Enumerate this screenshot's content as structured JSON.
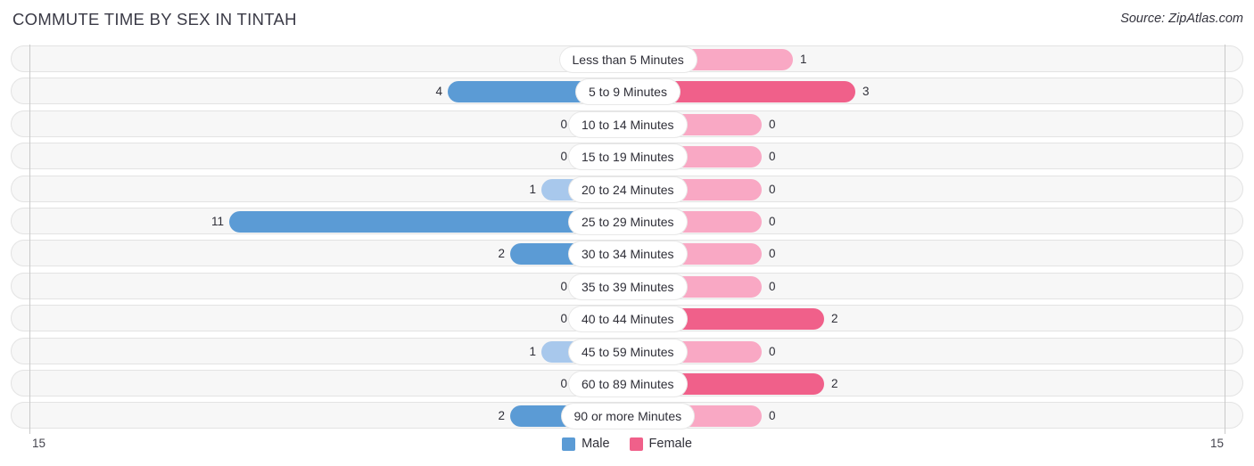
{
  "header": {
    "title": "COMMUTE TIME BY SEX IN TINTAH",
    "source": "Source: ZipAtlas.com"
  },
  "legend": {
    "male_label": "Male",
    "female_label": "Female",
    "male_color": "#5b9bd5",
    "female_color": "#f0608a"
  },
  "axis": {
    "left_tick": "15",
    "right_tick": "15",
    "max": 15
  },
  "chart_data": {
    "type": "bar",
    "orientation": "horizontal-diverging",
    "title": "COMMUTE TIME BY SEX IN TINTAH",
    "xlabel": "",
    "ylabel": "",
    "xlim": [
      15,
      15
    ],
    "grid": false,
    "legend_position": "bottom-center",
    "categories": [
      "Less than 5 Minutes",
      "5 to 9 Minutes",
      "10 to 14 Minutes",
      "15 to 19 Minutes",
      "20 to 24 Minutes",
      "25 to 29 Minutes",
      "30 to 34 Minutes",
      "35 to 39 Minutes",
      "40 to 44 Minutes",
      "45 to 59 Minutes",
      "60 to 89 Minutes",
      "90 or more Minutes"
    ],
    "series": [
      {
        "name": "Male",
        "color": "#5b9bd5",
        "values": [
          0,
          4,
          0,
          0,
          1,
          11,
          2,
          0,
          0,
          1,
          0,
          2
        ]
      },
      {
        "name": "Female",
        "color": "#f0608a",
        "values": [
          1,
          3,
          0,
          0,
          0,
          0,
          0,
          0,
          2,
          0,
          2,
          0
        ]
      }
    ]
  }
}
